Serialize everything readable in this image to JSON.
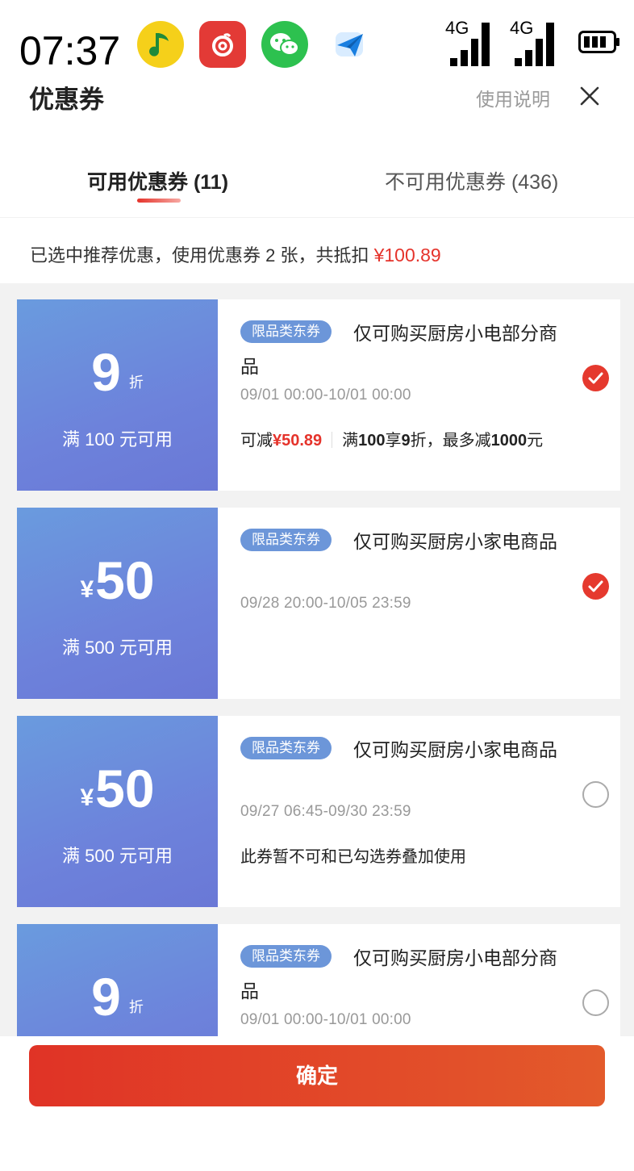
{
  "status_bar": {
    "time": "07:37",
    "network_1": "4G",
    "network_2": "4G",
    "icons": [
      "qq-music-icon",
      "netease-music-icon",
      "wechat-icon",
      "mail-icon",
      "signal-icon",
      "signal-icon",
      "battery-icon"
    ]
  },
  "header": {
    "title": "优惠券",
    "help_label": "使用说明",
    "close_icon": "close-icon"
  },
  "tabs": [
    {
      "label": "可用优惠券 (11)",
      "active": true
    },
    {
      "label": "不可用优惠券 (436)",
      "active": false
    }
  ],
  "summary": {
    "text": "已选中推荐优惠，使用优惠券 2 张，共抵扣 ",
    "amount": "¥100.89"
  },
  "coupons": [
    {
      "value": "9",
      "unit": "折",
      "currency": "",
      "condition": "满 100 元可用",
      "tag": "限品类东券",
      "description": "仅可购买厨房小电部分商品",
      "validity": "09/01 00:00-10/01 00:00",
      "note_prefix": "可减",
      "note_amount": "¥50.89",
      "note_rule_1": "满",
      "note_rule_2": "100",
      "note_rule_3": "享",
      "note_rule_4": "9",
      "note_rule_5": "折，最多减",
      "note_rule_6": "1000",
      "note_rule_7": "元",
      "selected": true
    },
    {
      "value": "50",
      "unit": "",
      "currency": "¥",
      "condition": "满 500 元可用",
      "tag": "限品类东券",
      "description": "仅可购买厨房小家电商品",
      "validity": "09/28 20:00-10/05 23:59",
      "selected": true
    },
    {
      "value": "50",
      "unit": "",
      "currency": "¥",
      "condition": "满 500 元可用",
      "tag": "限品类东券",
      "description": "仅可购买厨房小家电商品",
      "validity": "09/27 06:45-09/30 23:59",
      "note": "此券暂不可和已勾选券叠加使用",
      "selected": false
    },
    {
      "value": "9",
      "unit": "折",
      "currency": "",
      "condition": "",
      "tag": "限品类东券",
      "description": "仅可购买厨房小电部分商品",
      "validity": "09/01 00:00-10/01 00:00",
      "selected": false
    }
  ],
  "confirm_label": "确定",
  "colors": {
    "accent_red": "#e5332b",
    "coupon_blue": "#6c8cdb",
    "tag_blue": "#6c96d9"
  }
}
